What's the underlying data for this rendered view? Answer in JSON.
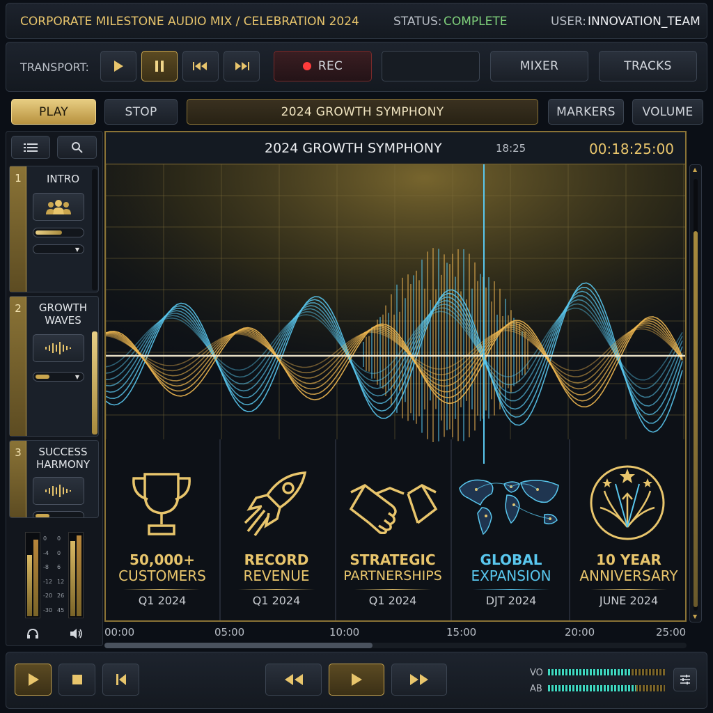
{
  "header": {
    "title": "CORPORATE MILESTONE AUDIO MIX / CELEBRATION 2024",
    "status_label": "STATUS:",
    "status_value": "COMPLETE",
    "user_label": "USER:",
    "user_value": "INNOVATION_TEAM"
  },
  "transport": {
    "label": "TRANSPORT:",
    "rec_label": "REC",
    "mixer_label": "MIXER",
    "tracks_label": "TRACKS"
  },
  "toolbar": {
    "play_label": "PLAY",
    "stop_label": "STOP",
    "track_name": "2024 GROWTH SYMPHONY",
    "markers_label": "MARKERS",
    "volume_label": "VOLUME"
  },
  "tracks": [
    {
      "num": "1",
      "name": "INTRO",
      "icon": "users-icon",
      "level": 0.55
    },
    {
      "num": "2",
      "name": "GROWTH\nWAVES",
      "icon": "waveform-icon",
      "level": 0.3
    },
    {
      "num": "3",
      "name": "SUCCESS\nHARMONY",
      "icon": "waveform-icon",
      "level": 0.3
    }
  ],
  "meters": {
    "scale_left": [
      "0",
      "-4",
      "-8",
      "-12",
      "-20",
      "-30"
    ],
    "scale_right": [
      "0",
      "0",
      "6",
      "12",
      "26",
      "45"
    ]
  },
  "waveform": {
    "title": "2024 GROWTH SYMPHONY",
    "playhead_time": "18:25",
    "timecode": "00:18:25:00"
  },
  "milestones": [
    {
      "title1": "50,000+",
      "title2": "CUSTOMERS",
      "date": "Q1 2024",
      "icon": "trophy-icon",
      "accent": "#e8c56c"
    },
    {
      "title1": "RECORD",
      "title2": "REVENUE",
      "date": "Q1 2024",
      "icon": "rocket-icon",
      "accent": "#e8c56c"
    },
    {
      "title1": "STRATEGIC",
      "title2": "PARTNERSHIPS",
      "date": "Q1 2024",
      "icon": "handshake-icon",
      "accent": "#e8c56c"
    },
    {
      "title1": "GLOBAL",
      "title2": "EXPANSION",
      "date": "DJT 2024",
      "icon": "world-map-icon",
      "accent": "#59c7ee"
    },
    {
      "title1": "10 YEAR",
      "title2": "ANNIVERSARY",
      "date": "JUNE 2024",
      "icon": "fireworks-icon",
      "accent": "#e8c56c"
    }
  ],
  "timeline": [
    "00:00",
    "05:00",
    "10:00",
    "15:00",
    "20:00",
    "25:00"
  ],
  "bottom": {
    "vo_label": "VO",
    "ab_label": "AB"
  },
  "colors": {
    "gold": "#e8c56c",
    "cyan": "#59c7ee",
    "status_green": "#7fd07b"
  }
}
